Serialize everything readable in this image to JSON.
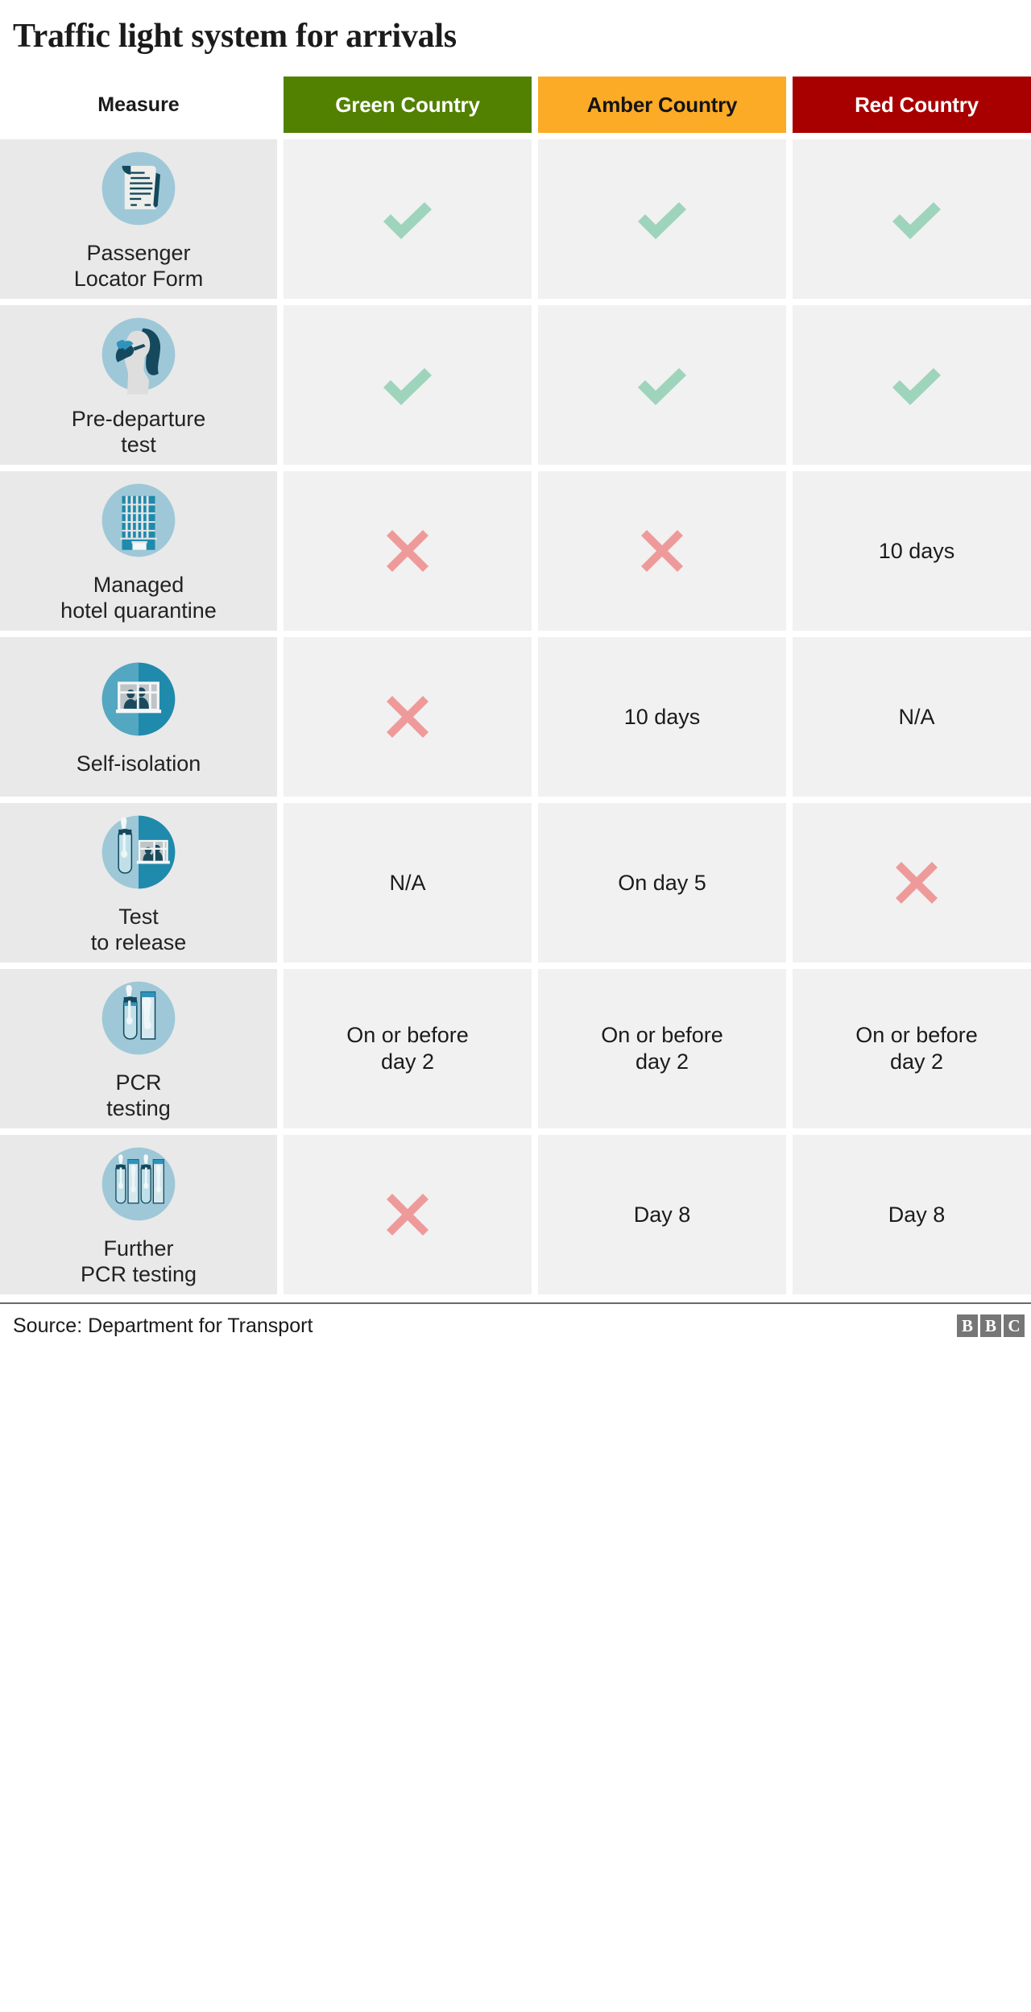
{
  "title": "Traffic light system for arrivals",
  "colors": {
    "green_header": "#528000",
    "amber_header": "#fcab27",
    "red_header": "#a80000",
    "tick": "#9ed4bb",
    "cross": "#ef9a9a",
    "measure_cell_bg": "#e9e9e9",
    "value_cell_bg": "#f1f1f1"
  },
  "header": {
    "measure": "Measure",
    "green": "Green Country",
    "amber": "Amber Country",
    "red": "Red Country"
  },
  "rows": [
    {
      "icon": "passenger-locator-form-icon",
      "label": "Passenger\nLocator Form",
      "green": "tick",
      "amber": "tick",
      "red": "tick"
    },
    {
      "icon": "pre-departure-swab-test-icon",
      "label": "Pre-departure\ntest",
      "green": "tick",
      "amber": "tick",
      "red": "tick"
    },
    {
      "icon": "hotel-building-icon",
      "label": "Managed\nhotel quarantine",
      "green": "cross",
      "amber": "cross",
      "red": "10 days"
    },
    {
      "icon": "people-at-window-icon",
      "label": "Self-isolation",
      "green": "cross",
      "amber": "10 days",
      "red": "N/A"
    },
    {
      "icon": "test-tube-and-window-icon",
      "label": "Test\nto release",
      "green": "N/A",
      "amber": "On day 5",
      "red": "cross"
    },
    {
      "icon": "two-test-tubes-icon",
      "label": "PCR\ntesting",
      "green": "On or before\nday 2",
      "amber": "On or before\nday 2",
      "red": "On or before\nday 2"
    },
    {
      "icon": "four-test-tubes-icon",
      "label": "Further\nPCR testing",
      "green": "cross",
      "amber": "Day 8",
      "red": "Day 8"
    }
  ],
  "footer": {
    "source": "Source: Department for Transport",
    "logo": [
      "B",
      "B",
      "C"
    ]
  },
  "chart_data": {
    "type": "table",
    "title": "Traffic light system for arrivals",
    "columns": [
      "Measure",
      "Green Country",
      "Amber Country",
      "Red Country"
    ],
    "rows": [
      [
        "Passenger Locator Form",
        "Yes",
        "Yes",
        "Yes"
      ],
      [
        "Pre-departure test",
        "Yes",
        "Yes",
        "Yes"
      ],
      [
        "Managed hotel quarantine",
        "No",
        "No",
        "10 days"
      ],
      [
        "Self-isolation",
        "No",
        "10 days",
        "N/A"
      ],
      [
        "Test to release",
        "N/A",
        "On day 5",
        "No"
      ],
      [
        "PCR testing",
        "On or before day 2",
        "On or before day 2",
        "On or before day 2"
      ],
      [
        "Further PCR testing",
        "No",
        "Day 8",
        "Day 8"
      ]
    ],
    "source": "Source: Department for Transport"
  }
}
